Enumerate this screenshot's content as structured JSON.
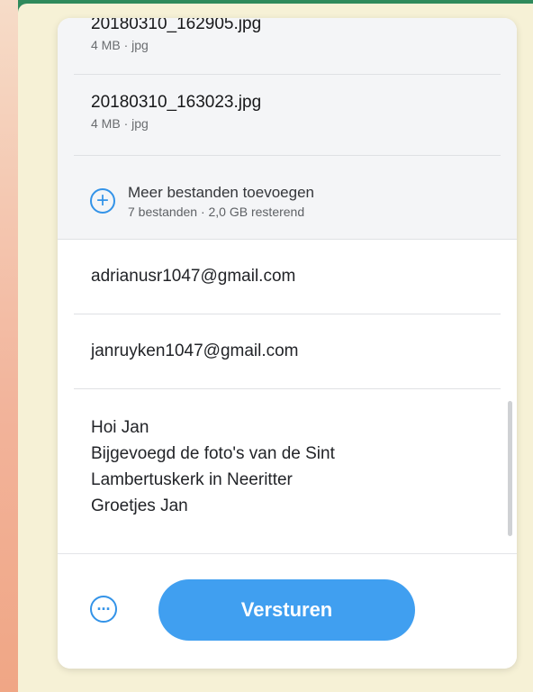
{
  "files": [
    {
      "name": "20180310_162905.jpg",
      "meta": "4 MB · jpg"
    },
    {
      "name": "20180310_163023.jpg",
      "meta": "4 MB · jpg"
    }
  ],
  "add_more": {
    "icon": "plus-circle-icon",
    "label": "Meer bestanden toevoegen",
    "meta": "7 bestanden · 2,0 GB resterend"
  },
  "recipient_email": "adrianusr1047@gmail.com",
  "sender_email": "janruyken1047@gmail.com",
  "message_lines": [
    "Hoi Jan",
    "Bijgevoegd de foto's van de Sint",
    "Lambertuskerk in Neeritter",
    "Groetjes Jan"
  ],
  "footer": {
    "more_icon": "ellipsis-icon",
    "more_glyph": "···",
    "send_label": "Versturen"
  },
  "colors": {
    "accent": "#409ff0",
    "panel": "#ffffff",
    "file_area": "#f4f5f7",
    "background": "#f6f1d6"
  }
}
